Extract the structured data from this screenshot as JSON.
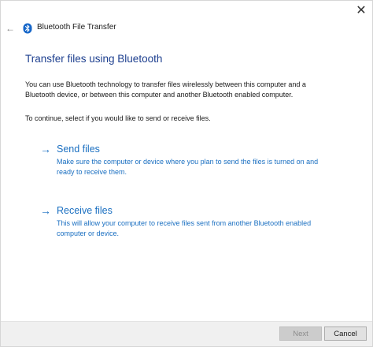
{
  "window": {
    "title": "Bluetooth File Transfer",
    "close_glyph": "✕",
    "back_glyph": "←",
    "icon": "bluetooth-icon"
  },
  "content": {
    "heading": "Transfer files using Bluetooth",
    "intro": "You can use Bluetooth technology to transfer files wirelessly between this computer and a Bluetooth device, or between this computer and another Bluetooth enabled computer.",
    "instruction": "To continue, select if you would like to send or receive files."
  },
  "options": [
    {
      "label": "Send files",
      "description": "Make sure the computer or device where you plan to send the files is turned on and ready to receive them.",
      "arrow": "→"
    },
    {
      "label": "Receive files",
      "description": "This will allow your computer to receive files sent from another Bluetooth enabled computer or device.",
      "arrow": "→"
    }
  ],
  "footer": {
    "next_label": "Next",
    "cancel_label": "Cancel"
  },
  "colors": {
    "heading": "#1d3f8f",
    "link": "#1a6fc1",
    "bluetooth": "#1767c9"
  }
}
